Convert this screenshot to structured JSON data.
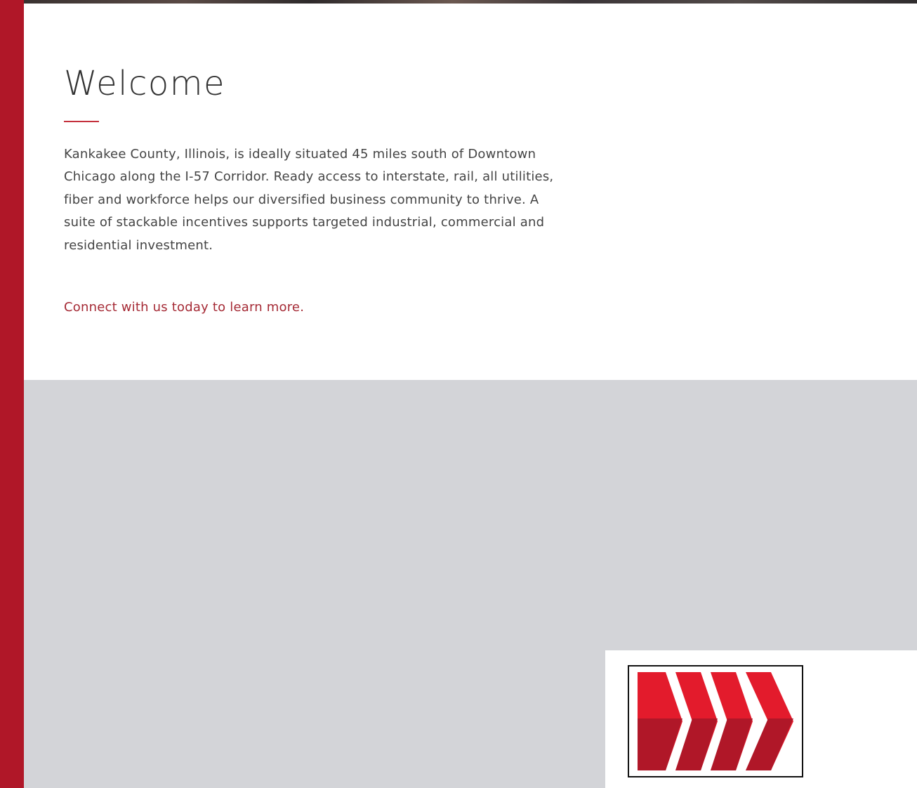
{
  "welcome": {
    "title": "Welcome",
    "body": "Kankakee County, Illinois, is ideally situated 45 miles south of Downtown Chicago along the I-57 Corridor. Ready access to interstate, rail, all utilities, fiber and workforce helps our diversified business community to thrive. A suite of stackable incentives supports targeted industrial, commercial and residential investment.",
    "cta_link": "Connect with us today to learn more."
  },
  "colors": {
    "brand_red": "#b01728",
    "chevron_light": "#e31b2c",
    "chevron_dark": "#b01728",
    "link_red": "#a52a35",
    "gray_band": "#d3d4d8"
  },
  "logo": {
    "icon": "chevron-arrows-logo-icon"
  }
}
